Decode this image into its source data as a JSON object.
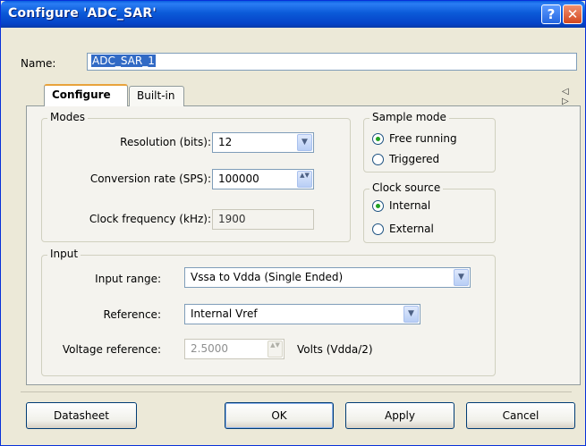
{
  "window": {
    "title": "Configure 'ADC_SAR'",
    "help_glyph": "?",
    "close_glyph": "✕"
  },
  "name_field": {
    "label": "Name:",
    "value": "ADC_SAR_1"
  },
  "tabs": [
    {
      "label": "Configure",
      "active": true
    },
    {
      "label": "Built-in",
      "active": false
    }
  ],
  "tab_scroll_glyph": "◁ ▷",
  "modes": {
    "legend": "Modes",
    "resolution": {
      "label": "Resolution (bits):",
      "value": "12"
    },
    "conversion_rate": {
      "label": "Conversion rate (SPS):",
      "value": "100000"
    },
    "clock_frequency": {
      "label": "Clock frequency (kHz):",
      "value": "1900"
    }
  },
  "sample_mode": {
    "legend": "Sample mode",
    "options": [
      {
        "label": "Free running",
        "checked": true
      },
      {
        "label": "Triggered",
        "checked": false
      }
    ]
  },
  "clock_source": {
    "legend": "Clock source",
    "options": [
      {
        "label": "Internal",
        "checked": true
      },
      {
        "label": "External",
        "checked": false
      }
    ]
  },
  "input": {
    "legend": "Input",
    "input_range": {
      "label": "Input range:",
      "value": "Vssa to Vdda (Single Ended)"
    },
    "reference": {
      "label": "Reference:",
      "value": "Internal Vref"
    },
    "voltage_reference": {
      "label": "Voltage reference:",
      "value": "2.5000",
      "unit": "Volts (Vdda/2)"
    }
  },
  "buttons": {
    "datasheet": "Datasheet",
    "ok": "OK",
    "apply": "Apply",
    "cancel": "Cancel"
  },
  "glyphs": {
    "dropdown": "▼",
    "spin": "▲▼"
  },
  "colors": {
    "titlebar": "#0b5ad8",
    "selection": "#316ac5",
    "radio_dot": "#21a121",
    "active_tab_accent": "#e8a33c"
  }
}
